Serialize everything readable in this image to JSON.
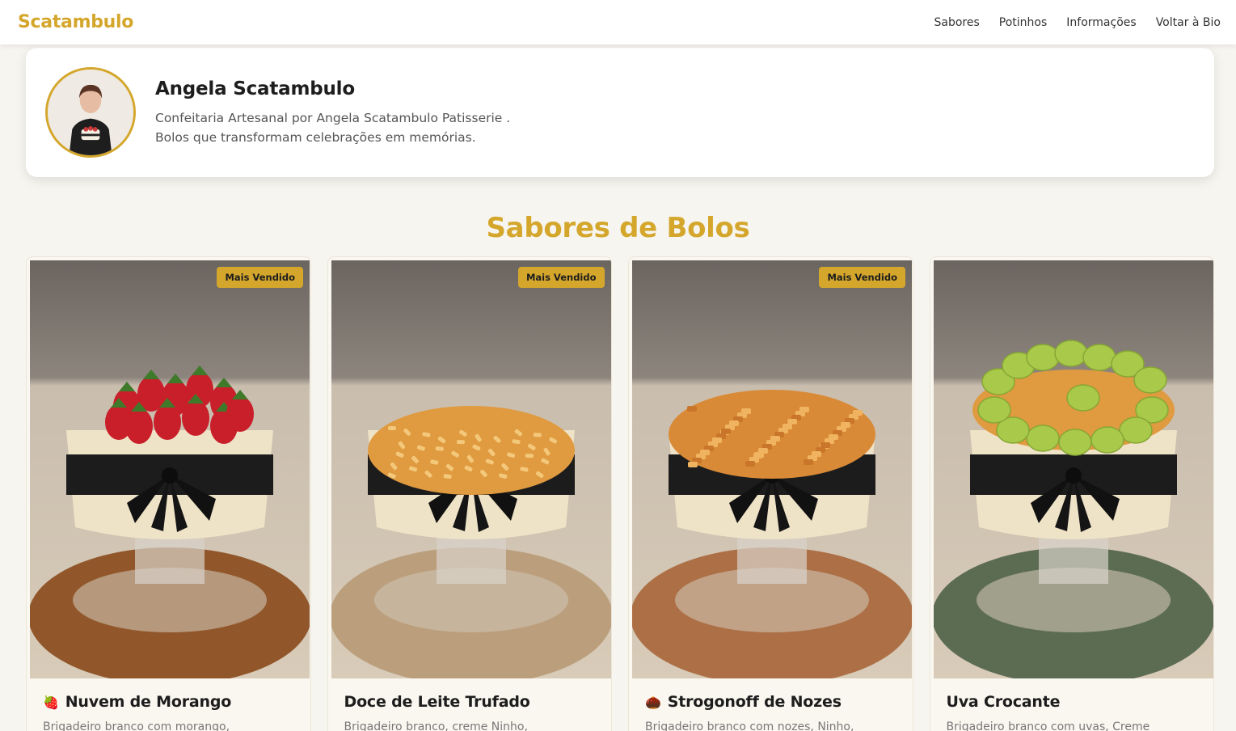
{
  "header": {
    "brand": "Scatambulo",
    "nav": [
      "Sabores",
      "Potinhos",
      "Informações",
      "Voltar à Bio"
    ]
  },
  "profile": {
    "name": "Angela Scatambulo",
    "desc_line1": "Confeitaria Artesanal por Angela Scatambulo Patisserie .",
    "desc_line2": "Bolos que transformam celebrações em memórias."
  },
  "section": {
    "title": "Sabores de Bolos"
  },
  "cards": [
    {
      "badge": "Mais Vendido",
      "emoji": "🍓",
      "title": "Nuvem de Morango",
      "desc": "Brigadeiro branco com morango,",
      "topping": "strawberry"
    },
    {
      "badge": "Mais Vendido",
      "emoji": "",
      "title": "Doce de Leite Trufado",
      "desc": "Brigadeiro branco, creme Ninho,",
      "topping": "crumble"
    },
    {
      "badge": "Mais Vendido",
      "emoji": "🌰",
      "title": "Strogonoff de Nozes",
      "desc": "Brigadeiro branco com nozes, Ninho,",
      "topping": "nuts"
    },
    {
      "badge": "",
      "emoji": "",
      "title": "Uva Crocante",
      "desc": "Brigadeiro branco com uvas, Creme",
      "topping": "grape"
    }
  ],
  "colors": {
    "accent": "#d4a72c",
    "background": "#f7f5f0"
  }
}
